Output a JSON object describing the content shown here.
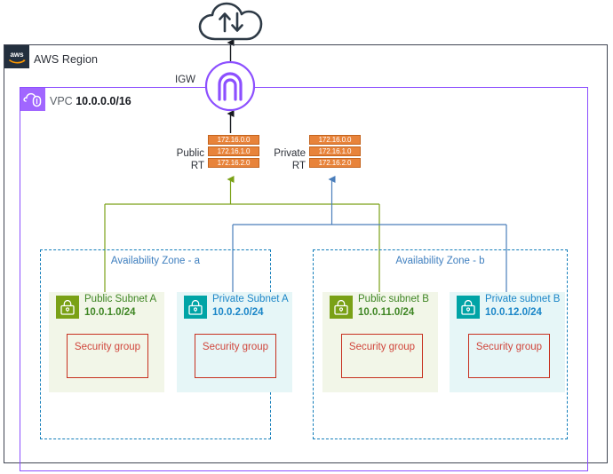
{
  "region": {
    "title": "AWS Region",
    "logo_icon": "aws-logo-icon"
  },
  "vpc": {
    "label": "VPC",
    "cidr": "10.0.0.0/16",
    "icon": "vpc-icon"
  },
  "internet": {
    "icon": "internet-cloud-icon"
  },
  "igw": {
    "label": "IGW",
    "icon": "internet-gateway-icon"
  },
  "route_tables": [
    {
      "name": "public-route-table",
      "label": "Public\nRT",
      "label_line1": "Public",
      "label_line2": "RT",
      "routes": [
        "172.16.0.0",
        "172.16.1.0",
        "172.16.2.0"
      ],
      "accent": "#7AA116"
    },
    {
      "name": "private-route-table",
      "label_line1": "Private",
      "label_line2": "RT",
      "routes": [
        "172.16.0.0",
        "172.16.1.0",
        "172.16.2.0"
      ],
      "accent": "#4A7EBB"
    }
  ],
  "availability_zones": [
    {
      "title": "Availability Zone - a",
      "subnets": [
        {
          "type": "public",
          "name": "Public Subnet A",
          "cidr": "10.0.1.0/24",
          "icon": "subnet-lock-icon",
          "security_group": "Security group"
        },
        {
          "type": "private",
          "name": "Private Subnet A",
          "cidr": "10.0.2.0/24",
          "icon": "subnet-lock-icon",
          "security_group": "Security group"
        }
      ]
    },
    {
      "title": "Availability Zone - b",
      "subnets": [
        {
          "type": "public",
          "name": "Public subnet B",
          "cidr": "10.0.11.0/24",
          "icon": "subnet-lock-icon",
          "security_group": "Security group"
        },
        {
          "type": "private",
          "name": "Private subnet B",
          "cidr": "10.0.12.0/24",
          "icon": "subnet-lock-icon",
          "security_group": "Security group"
        }
      ]
    }
  ],
  "colors": {
    "aws_navy": "#232F3E",
    "vpc_purple": "#8C4FFF",
    "route_table_orange": "#E8833A",
    "public_green": "#7AA116",
    "private_teal": "#00A4A6",
    "az_blue": "#147EBA",
    "security_group_red": "#C7301F"
  }
}
